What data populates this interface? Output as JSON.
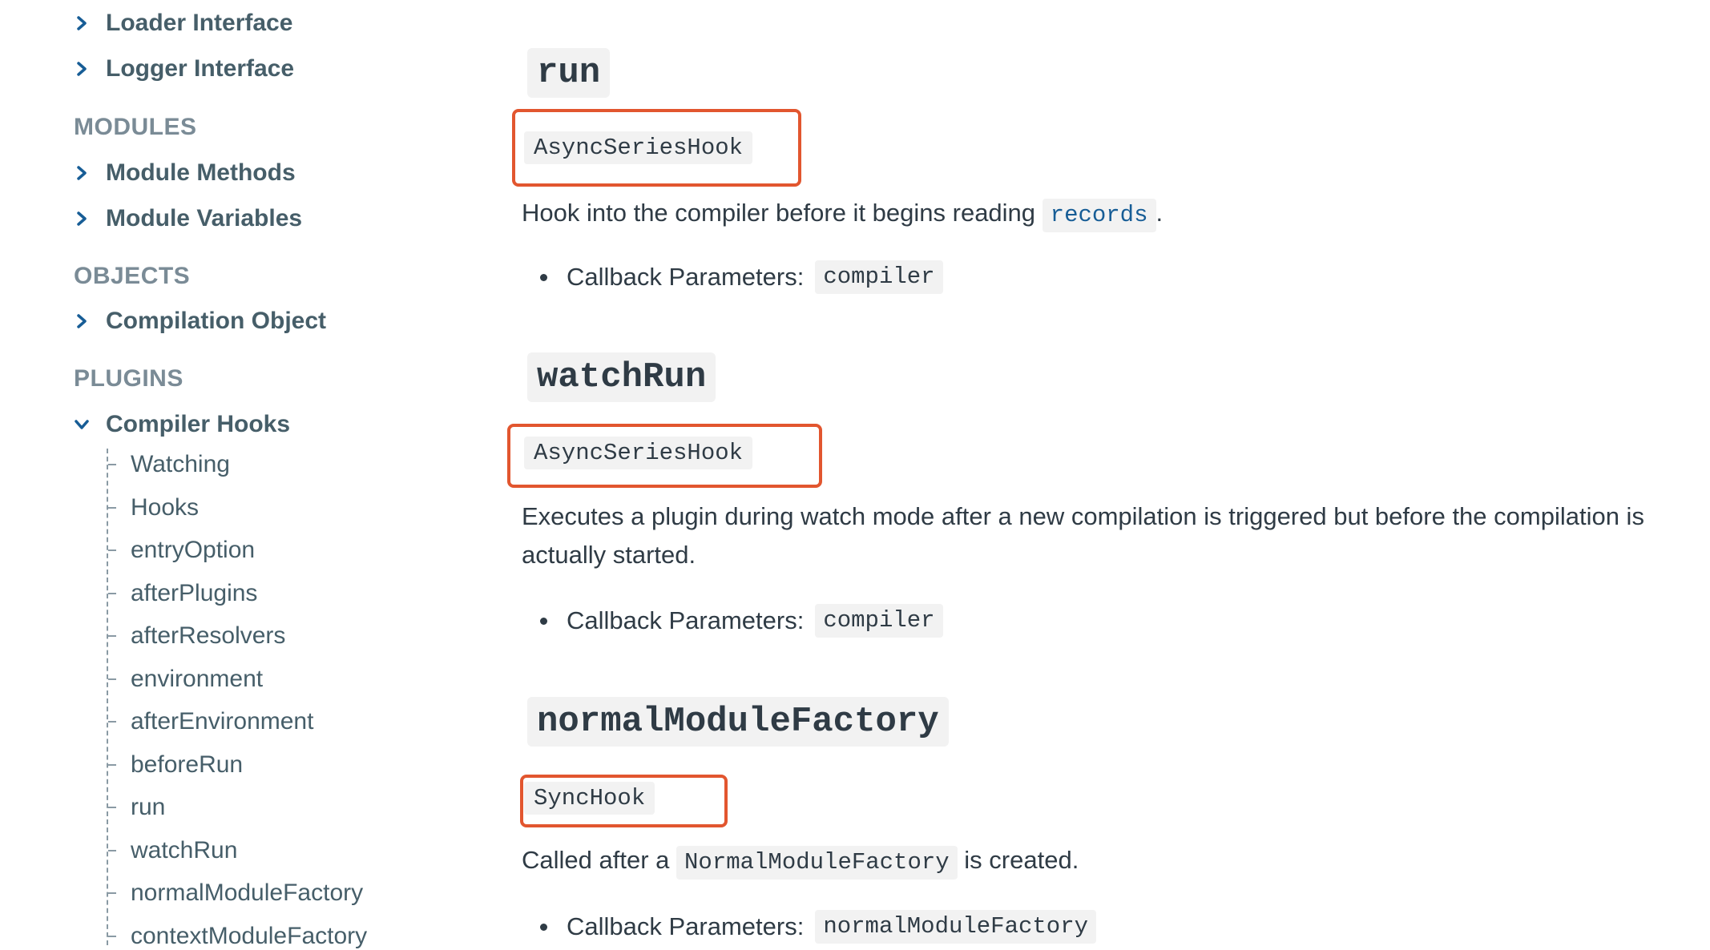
{
  "sidebar": {
    "top_items": [
      {
        "label": "Loader Interface"
      },
      {
        "label": "Logger Interface"
      }
    ],
    "sections": [
      {
        "label": "MODULES",
        "items": [
          {
            "label": "Module Methods"
          },
          {
            "label": "Module Variables"
          }
        ]
      },
      {
        "label": "OBJECTS",
        "items": [
          {
            "label": "Compilation Object"
          }
        ]
      },
      {
        "label": "PLUGINS",
        "items": [
          {
            "label": "Compiler Hooks"
          }
        ]
      }
    ],
    "sub_items": [
      "Watching",
      "Hooks",
      "entryOption",
      "afterPlugins",
      "afterResolvers",
      "environment",
      "afterEnvironment",
      "beforeRun",
      "run",
      "watchRun",
      "normalModuleFactory",
      "contextModuleFactory"
    ]
  },
  "main": {
    "hooks": [
      {
        "name": "run",
        "type": "AsyncSeriesHook",
        "desc_before": "Hook into the compiler before it begins reading",
        "desc_code": "records",
        "desc_after": ".",
        "param_label": "Callback Parameters:",
        "param_value": "compiler"
      },
      {
        "name": "watchRun",
        "type": "AsyncSeriesHook",
        "desc": "Executes a plugin during watch mode after a new compilation is triggered but before the compilation is actually started.",
        "param_label": "Callback Parameters:",
        "param_value": "compiler"
      },
      {
        "name": "normalModuleFactory",
        "type": "SyncHook",
        "desc_before": "Called after a",
        "desc_code": "NormalModuleFactory",
        "desc_after": "is created.",
        "param_label": "Callback Parameters:",
        "param_value": "normalModuleFactory"
      }
    ]
  },
  "colors": {
    "highlight_box": "#e2562f",
    "link": "#175d96",
    "code_bg": "#f2f2f2",
    "section_label": "#7a8b96"
  },
  "icons": {
    "collapsed": "chevron-right-icon",
    "expanded": "chevron-down-icon"
  }
}
